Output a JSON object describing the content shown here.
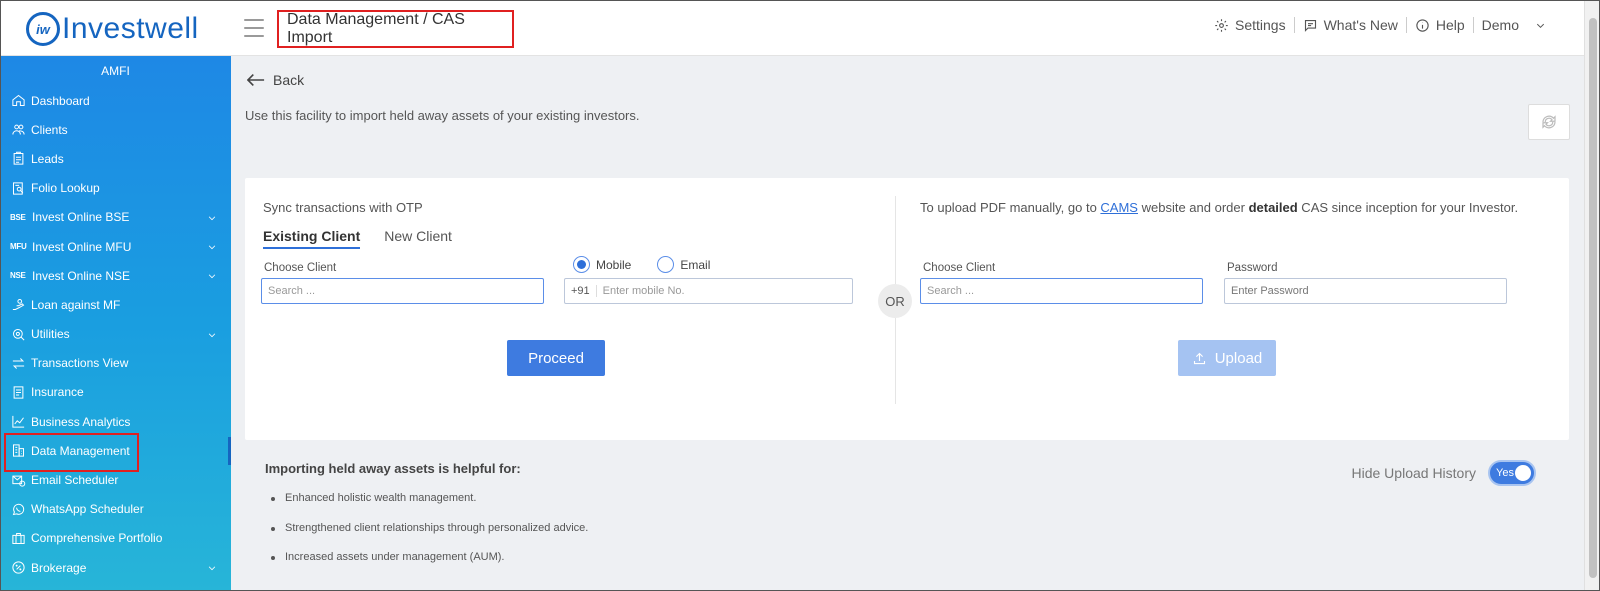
{
  "app": {
    "logo_badge": "iw",
    "logo_text": "Investwell"
  },
  "header": {
    "breadcrumb": "Data Management / CAS Import",
    "settings": "Settings",
    "whats_new": "What's New",
    "help": "Help",
    "user": "Demo"
  },
  "sidebar": {
    "title": "AMFI",
    "items": [
      {
        "label": "Dashboard"
      },
      {
        "label": "Clients"
      },
      {
        "label": "Leads"
      },
      {
        "label": "Folio Lookup"
      },
      {
        "label": "Invest Online BSE",
        "tag": "BSE"
      },
      {
        "label": "Invest Online MFU",
        "tag": "MFU"
      },
      {
        "label": "Invest Online NSE",
        "tag": "NSE"
      },
      {
        "label": "Loan against MF"
      },
      {
        "label": "Utilities"
      },
      {
        "label": "Transactions View"
      },
      {
        "label": "Insurance"
      },
      {
        "label": "Business Analytics"
      },
      {
        "label": "Data Management"
      },
      {
        "label": "Email Scheduler"
      },
      {
        "label": "WhatsApp Scheduler"
      },
      {
        "label": "Comprehensive Portfolio"
      },
      {
        "label": "Brokerage"
      }
    ]
  },
  "main": {
    "back": "Back",
    "intro": "Use this facility to import held away assets of your existing investors.",
    "sync": {
      "title": "Sync transactions with OTP",
      "tabs": [
        "Existing Client",
        "New Client"
      ],
      "choose_client_label": "Choose Client",
      "search_placeholder": "Search ...",
      "radio_mobile": "Mobile",
      "radio_email": "Email",
      "country_code": "+91",
      "mobile_placeholder": "Enter mobile No.",
      "proceed": "Proceed"
    },
    "or": "OR",
    "upload": {
      "note_prefix": "To upload PDF manually, go to ",
      "note_link": "CAMS",
      "note_middle": " website and order ",
      "note_bold": "detailed",
      "note_suffix": " CAS since inception for your Investor.",
      "choose_client_label": "Choose Client",
      "search_placeholder": "Search ...",
      "password_label": "Password",
      "password_placeholder": "Enter Password",
      "upload_button": "Upload"
    },
    "benefits": {
      "title": "Importing held away assets is helpful for:",
      "items": [
        "Enhanced holistic wealth management.",
        "Strengthened client relationships through personalized advice.",
        "Increased assets under management (AUM)."
      ]
    },
    "history": {
      "label": "Hide Upload History",
      "toggle_text": "Yes"
    }
  },
  "colors": {
    "accent": "#3e7be0",
    "sidebar_top": "#1e88e5",
    "sidebar_bottom": "#27b5d8",
    "highlight": "#e02020"
  }
}
